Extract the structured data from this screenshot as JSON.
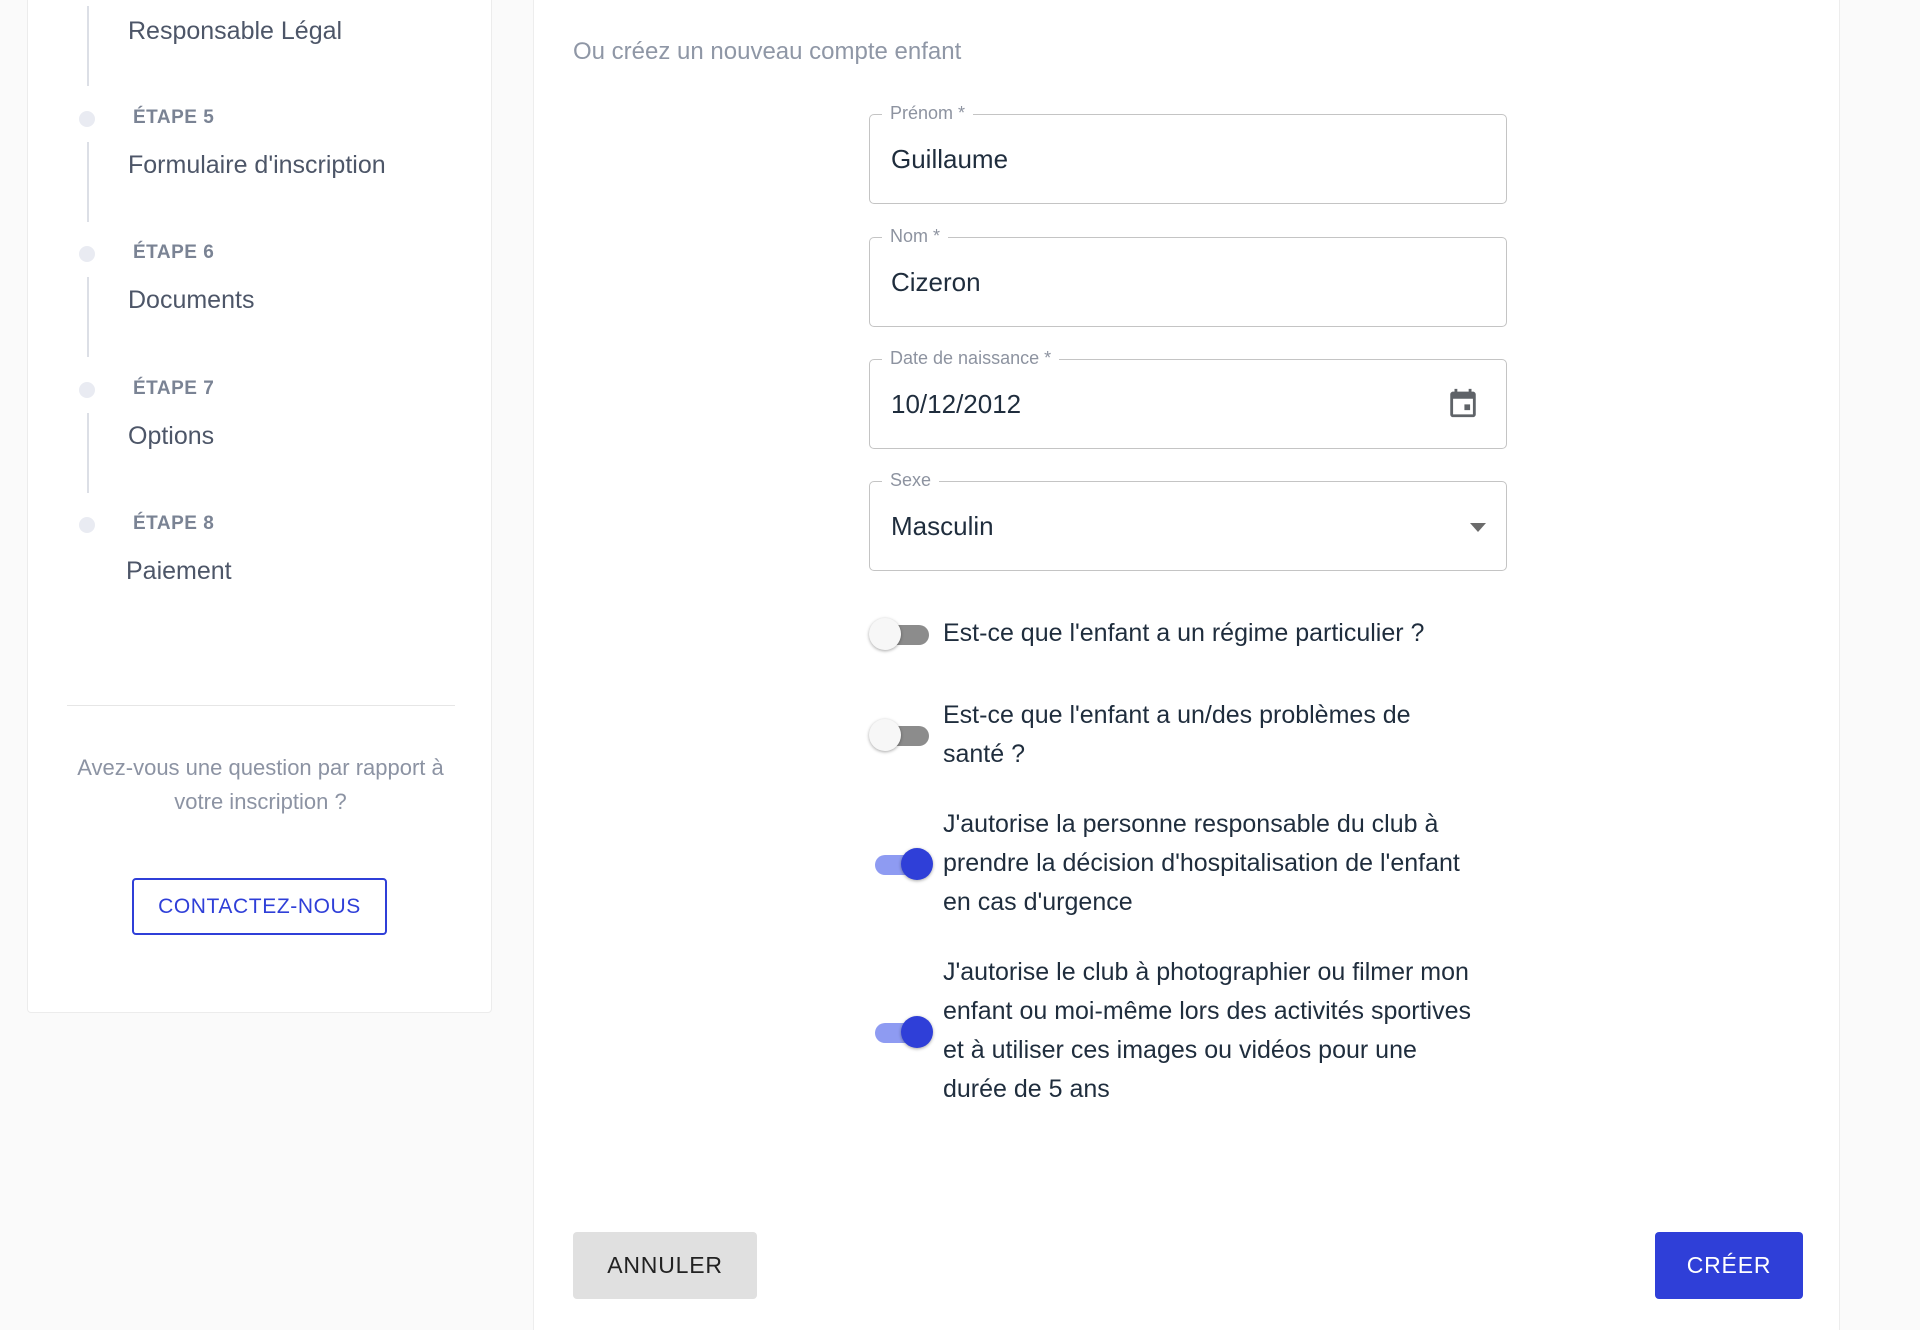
{
  "sidebar": {
    "current_step_title": "Responsable Légal",
    "steps": [
      {
        "label": "ÉTAPE 5",
        "title": "Formulaire d'inscription"
      },
      {
        "label": "ÉTAPE 6",
        "title": "Documents"
      },
      {
        "label": "ÉTAPE 7",
        "title": "Options"
      },
      {
        "label": "ÉTAPE 8",
        "title": "Paiement"
      }
    ],
    "help_text": "Avez-vous une question par rapport à votre inscription ?",
    "contact_button": "CONTACTEZ-NOUS"
  },
  "form": {
    "subtitle": "Ou créez un nouveau compte enfant",
    "fields": {
      "prenom": {
        "label": "Prénom *",
        "value": "Guillaume"
      },
      "nom": {
        "label": "Nom *",
        "value": "Cizeron"
      },
      "birthdate": {
        "label": "Date de naissance *",
        "value": "10/12/2012",
        "icon": "calendar-icon"
      },
      "sexe": {
        "label": "Sexe",
        "value": "Masculin",
        "icon": "dropdown-arrow-icon"
      }
    },
    "switches": [
      {
        "label": "Est-ce que l'enfant a un régime particulier ?",
        "checked": false
      },
      {
        "label": "Est-ce que l'enfant a un/des problèmes de santé ?",
        "checked": false
      },
      {
        "label": "J'autorise la personne responsable du club à prendre la décision d'hospitalisation de l'enfant en cas d'urgence",
        "checked": true
      },
      {
        "label": "J'autorise le club à photographier ou filmer mon enfant ou moi-même lors des activités sportives et à utiliser ces images ou vidéos pour une durée de 5 ans",
        "checked": true
      }
    ],
    "cancel_button": "ANNULER",
    "create_button": "CRÉER"
  },
  "colors": {
    "primary": "#2f3fd8",
    "switch_track_on": "#8e9bf2",
    "switch_track_off": "#8c8c8c"
  }
}
